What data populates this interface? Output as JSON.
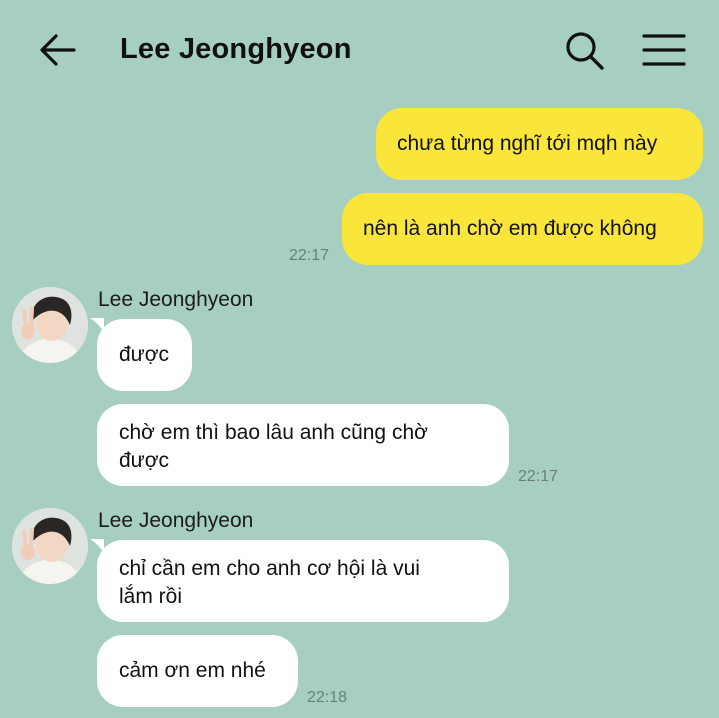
{
  "header": {
    "title": "Lee Jeonghyeon",
    "back_icon": "arrow-left-icon",
    "search_icon": "search-icon",
    "menu_icon": "hamburger-menu-icon"
  },
  "colors": {
    "background": "#a6cfc1",
    "outgoing_bubble": "#fae53b",
    "incoming_bubble": "#ffffff",
    "timestamp": "#6a7f78"
  },
  "messages": {
    "out_1": "chưa từng nghĩ tới mqh này",
    "out_2": "nên là anh chờ em được không",
    "out_time": "22:17",
    "group1": {
      "sender": "Lee Jeonghyeon",
      "msg_1": "được",
      "msg_2": "chờ em thì bao lâu anh cũng chờ\nđược",
      "time": "22:17"
    },
    "group2": {
      "sender": "Lee Jeonghyeon",
      "msg_1": "chỉ cần em cho anh cơ hội là vui\nlắm rồi",
      "msg_2": "cảm ơn em nhé",
      "time": "22:18"
    }
  }
}
